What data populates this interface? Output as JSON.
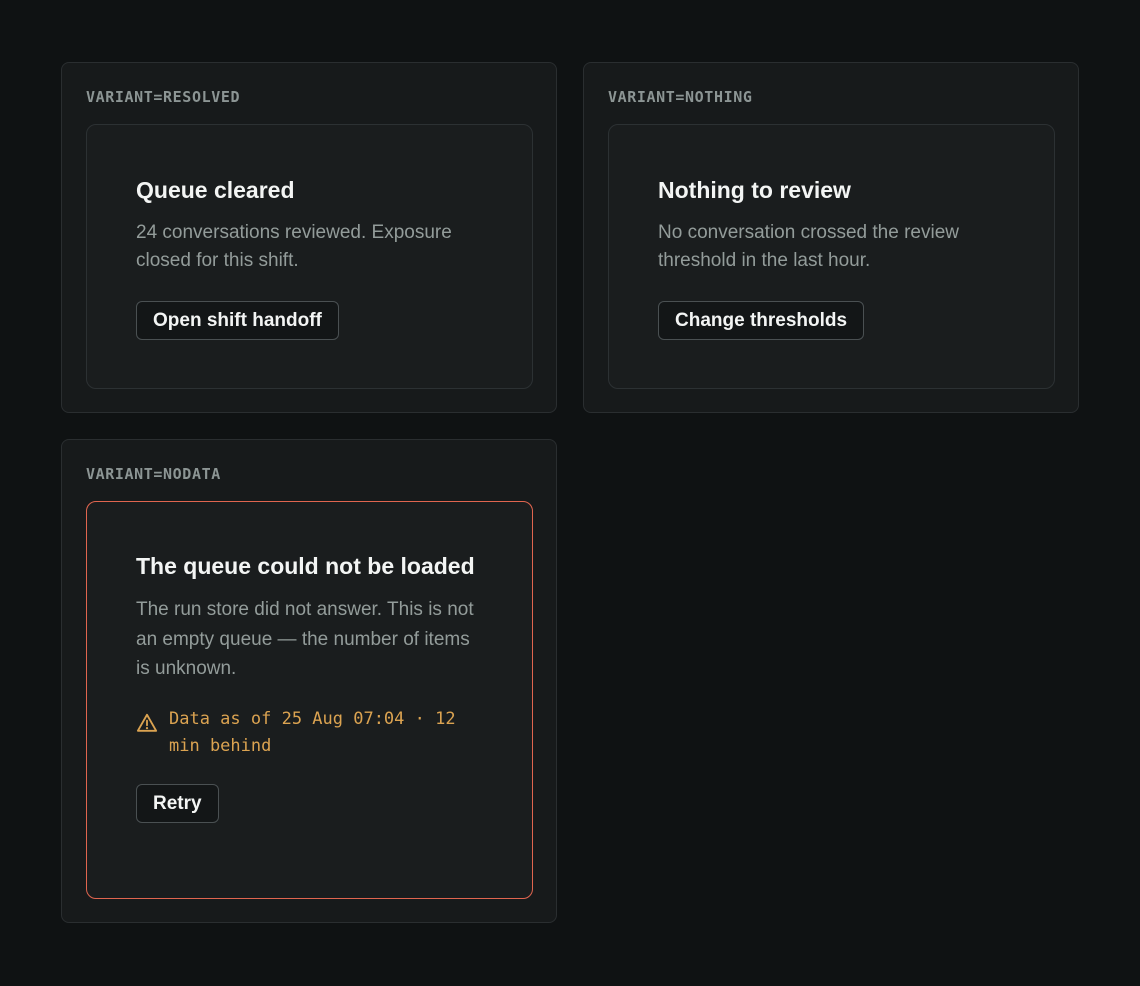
{
  "variants": {
    "resolved": {
      "label": "VARIANT=RESOLVED",
      "title": "Queue cleared",
      "body": "24 conversations reviewed. Exposure closed for this shift.",
      "action_label": "Open shift handoff"
    },
    "nothing": {
      "label": "VARIANT=NOTHING",
      "title": "Nothing to review",
      "body": "No conversation crossed the review threshold in the last hour.",
      "action_label": "Change thresholds"
    },
    "nodata": {
      "label": "VARIANT=NODATA",
      "title": "The queue could not be loaded",
      "body": "The run store did not answer. This is not an empty queue — the number of items is unknown.",
      "staleness": "Data as of 25 Aug 07:04 · 12 min behind",
      "action_label": "Retry"
    }
  },
  "icons": {
    "staleness": "warning-triangle-icon"
  },
  "colors": {
    "background": "#0f1213",
    "panel": "#171a1b",
    "card": "#1a1d1e",
    "error_border": "#e0654f",
    "warning_text": "#dba351",
    "muted_text": "#939c9a"
  }
}
